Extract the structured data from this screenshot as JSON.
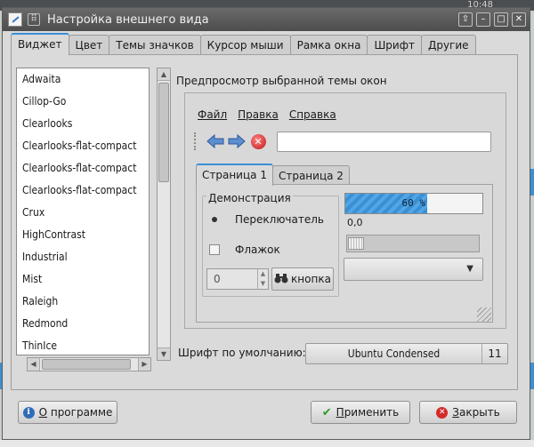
{
  "desktop": {
    "clock": "10:48"
  },
  "window": {
    "title": "Настройка внешнего вида",
    "controls": [
      "⇧",
      "–",
      "□",
      "✕"
    ]
  },
  "tabs": [
    "Виджет",
    "Цвет",
    "Темы значков",
    "Курсор мыши",
    "Рамка окна",
    "Шрифт",
    "Другие"
  ],
  "themes": [
    "Adwaita",
    "Cillop-Go",
    "Clearlooks",
    "Clearlooks-flat-compact",
    "Clearlooks-flat-compact",
    "Clearlooks-flat-compact",
    "Crux",
    "HighContrast",
    "Industrial",
    "Mist",
    "Raleigh",
    "Redmond",
    "ThinIce"
  ],
  "preview": {
    "title": "Предпросмотр выбранной темы окон",
    "menu": [
      "Файл",
      "Правка",
      "Справка"
    ],
    "inner_tabs": [
      "Страница 1",
      "Страница 2"
    ],
    "demo_label": "Демонстрация",
    "radio_label": "Переключатель",
    "checkbox_label": "Флажок",
    "spin_value": "0",
    "button_label": "кнопка",
    "progress_text": "60 %",
    "progress_fraction": 0.6,
    "scale_value": "0,0"
  },
  "font": {
    "label": "Шрифт по умолчанию:",
    "name": "Ubuntu Condensed",
    "size": "11"
  },
  "buttons": {
    "about": "О программе",
    "apply": "Применить",
    "close": "Закрыть"
  },
  "colors": {
    "accent": "#3b8ed6",
    "progress": "#4a9ee0",
    "stop": "#d42a2a"
  }
}
